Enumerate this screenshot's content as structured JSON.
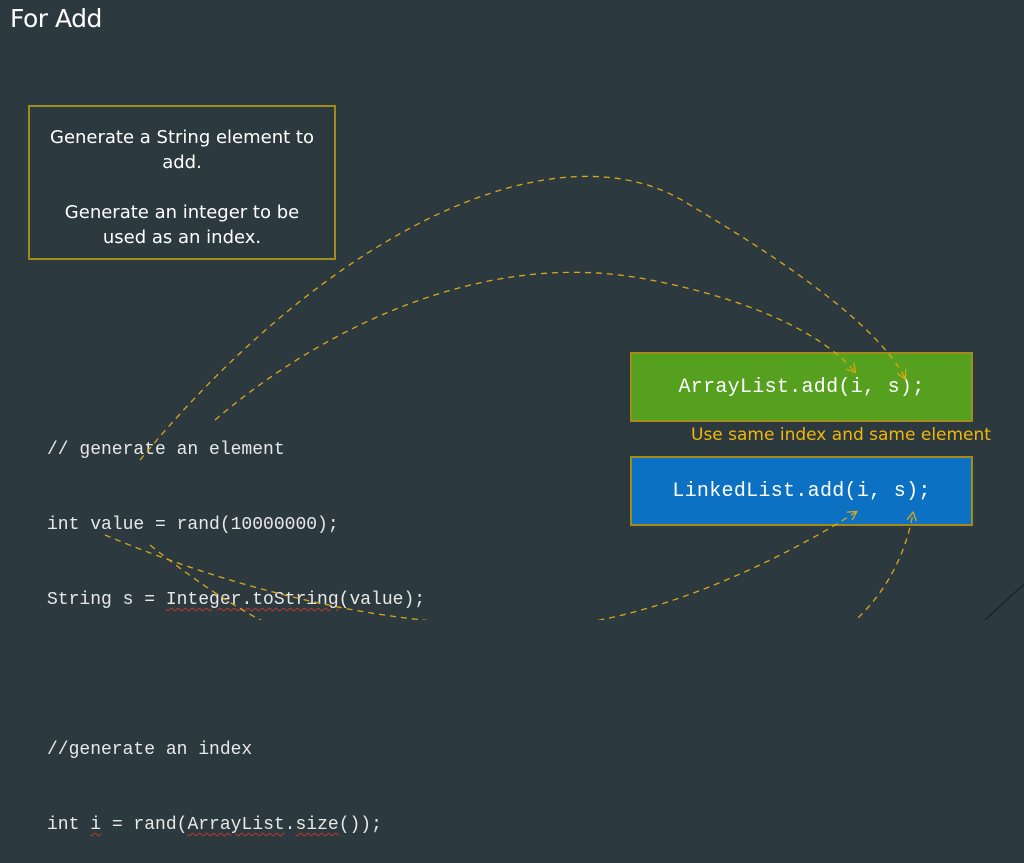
{
  "slide": {
    "title": "For Add"
  },
  "note": {
    "line1": "Generate a String element to add.",
    "line2": "Generate an integer to be used as an index."
  },
  "code": {
    "l1": "// generate an element",
    "l2_a": "int value = rand(10000000);",
    "l3_a": "String s = ",
    "l3_b": "Integer.toString",
    "l3_c": "(value);",
    "l4": "//generate an index",
    "l5_a": "int ",
    "l5_b": "i",
    "l5_c": " = rand(",
    "l5_d": "ArrayList",
    "l5_e": ".",
    "l5_f": "size",
    "l5_g": "());"
  },
  "methods": {
    "arraylist_call": "ArrayList.add(i, s);",
    "linkedlist_call": "LinkedList.add(i, s);"
  },
  "caption": {
    "text": "Use same index and same element"
  },
  "colors": {
    "background": "#2c3a40",
    "arraylist_fill": "#55a01e",
    "linkedlist_fill": "#0d71c3",
    "box_border": "#a38a1c",
    "arrow": "#d9a718",
    "caption": "#f2b705"
  }
}
